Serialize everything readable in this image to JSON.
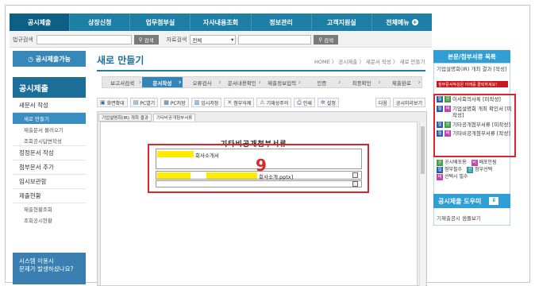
{
  "nav": {
    "tabs": [
      "공시제출",
      "상장신청",
      "업무첨부실",
      "자사내용조회",
      "정보관리",
      "고객지원실",
      "전체메뉴"
    ],
    "all_menu_plus": "+"
  },
  "search": {
    "label1": "법규검색",
    "button": "검색",
    "label2": "자료검색",
    "select_value": "전체",
    "button2": "검색"
  },
  "sidebar": {
    "cta": "공시제출가능",
    "title": "공시제출",
    "items": [
      {
        "label": "새문서 작성",
        "type": "item"
      },
      {
        "label": "새로 만들기",
        "type": "sub",
        "active": true
      },
      {
        "label": "제출문서 불러오기",
        "type": "sub"
      },
      {
        "label": "조회공시답변작성",
        "type": "sub"
      },
      {
        "label": "정정문서 작성",
        "type": "item"
      },
      {
        "label": "첨부문서 추가",
        "type": "item"
      },
      {
        "label": "임시보관함",
        "type": "item"
      },
      {
        "label": "제출현황",
        "type": "item"
      },
      {
        "label": "제출현황조회",
        "type": "sub"
      },
      {
        "label": "조회공시현황",
        "type": "sub"
      }
    ],
    "help_line1": "시스템 이용시",
    "help_line2": "문제가 발생하셨나요?"
  },
  "main": {
    "title": "새로 만들기",
    "breadcrumb": "HOME 〉 공시제출 〉 새문서 작성 〉 새로 만들기",
    "steps": [
      "보고서검색",
      "문서작성",
      "오류검사",
      "문서내용확인",
      "제출정보입력",
      "인증",
      "최종확인",
      "제출완료"
    ],
    "active_step": 1,
    "toolbar": [
      {
        "icon": "▣",
        "label": "화면확대",
        "name": "zoom-button"
      },
      {
        "icon": "▤",
        "label": "PC열기",
        "name": "pc-open-button"
      },
      {
        "icon": "▦",
        "label": "PC저장",
        "name": "pc-save-button"
      },
      {
        "icon": "▥",
        "label": "임시저장",
        "name": "temp-save-button"
      },
      {
        "icon": "✕",
        "label": "첨부삭제",
        "name": "delete-attachment-button"
      },
      {
        "icon": "⚠",
        "label": "기재상주의",
        "name": "notice-button"
      },
      {
        "icon": "⎙",
        "label": "인쇄",
        "name": "print-button"
      },
      {
        "icon": "✲",
        "label": "설정",
        "name": "settings-button"
      }
    ],
    "toolbar_right": [
      "다음",
      "공시미리보기"
    ],
    "doc_tabs": [
      "기업설명회(IR) 개최 결과",
      "기타비공개첨부서류"
    ],
    "doc_title": "기타비공개첨부서류",
    "field1_label": "회사소개서",
    "field2_label": "회사소개.pptx]",
    "callout_number": "9"
  },
  "right_panel": {
    "head": "본문/첨부서류 목록",
    "text1": "기업설명회(IR) 개최 결과 [작성]",
    "red_label": "첨부문서작성은 아래를 클릭하세요!",
    "list": [
      {
        "badges": [
          "b",
          "g"
        ],
        "label": "이사회의사록 [미작성]"
      },
      {
        "badges": [
          "b",
          "m"
        ],
        "label": "기업설명회 개최 확인서 [미작성]"
      },
      {
        "badges": [
          "b",
          "g"
        ],
        "label": "기타공개첨부서류 [미작성]"
      },
      {
        "badges": [
          "b",
          "m"
        ],
        "label": "기타비공개첨부서류 [작성]"
      }
    ],
    "legend": [
      {
        "badge": "g",
        "label": "공시배포용",
        "badge2": "m",
        "label2": "배포안됨"
      },
      {
        "badge": "b",
        "label": "첨부필수",
        "badge2": "t",
        "label2": "첨부선택"
      },
      {
        "badge": "m",
        "label": "선택시 필수",
        "badge2": "",
        "label2": ""
      }
    ],
    "help_head": "공시제출 도우미",
    "help_icon": "ⅱ",
    "help_text": "기제출공시 샘플보기"
  }
}
